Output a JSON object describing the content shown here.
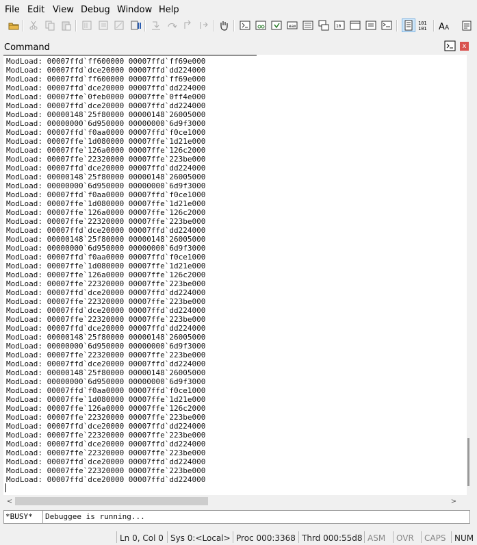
{
  "menu": [
    "File",
    "Edit",
    "View",
    "Debug",
    "Window",
    "Help"
  ],
  "toolbar": {
    "icons": [
      "open-icon",
      "cut-icon",
      "copy-icon",
      "paste-icon",
      "go-icon",
      "restart-icon",
      "stop-icon",
      "break-icon",
      "step-into-icon",
      "step-over-icon",
      "step-out-icon",
      "run-to-cursor-icon",
      "hand-icon",
      "command-window-icon",
      "watch-window-icon",
      "locals-window-icon",
      "registers-window-icon",
      "memory-window-icon",
      "call-stack-icon",
      "disassembly-icon",
      "scratch-pad-icon",
      "processes-threads-icon",
      "command-browser-icon",
      "source-mode-icon",
      "hex-mode-icon",
      "font-icon",
      "options-icon"
    ]
  },
  "command_window": {
    "title": "Command",
    "close_glyph": "x",
    "lines": [
      "ModLoad: 00007ffd`ff600000 00007ffd`ff69e000",
      "ModLoad: 00007ffd`dce20000 00007ffd`dd224000",
      "ModLoad: 00007ffd`ff600000 00007ffd`ff69e000",
      "ModLoad: 00007ffd`dce20000 00007ffd`dd224000",
      "ModLoad: 00007ffe`0feb0000 00007ffe`0ff4e000",
      "ModLoad: 00007ffd`dce20000 00007ffd`dd224000",
      "ModLoad: 00000148`25f80000 00000148`26005000",
      "ModLoad: 00000000`6d950000 00000000`6d9f3000",
      "ModLoad: 00007ffd`f0aa0000 00007ffd`f0ce1000",
      "ModLoad: 00007ffe`1d080000 00007ffe`1d21e000",
      "ModLoad: 00007ffe`126a0000 00007ffe`126c2000",
      "ModLoad: 00007ffe`22320000 00007ffe`223be000",
      "ModLoad: 00007ffd`dce20000 00007ffd`dd224000",
      "ModLoad: 00000148`25f80000 00000148`26005000",
      "ModLoad: 00000000`6d950000 00000000`6d9f3000",
      "ModLoad: 00007ffd`f0aa0000 00007ffd`f0ce1000",
      "ModLoad: 00007ffe`1d080000 00007ffe`1d21e000",
      "ModLoad: 00007ffe`126a0000 00007ffe`126c2000",
      "ModLoad: 00007ffe`22320000 00007ffe`223be000",
      "ModLoad: 00007ffd`dce20000 00007ffd`dd224000",
      "ModLoad: 00000148`25f80000 00000148`26005000",
      "ModLoad: 00000000`6d950000 00000000`6d9f3000",
      "ModLoad: 00007ffd`f0aa0000 00007ffd`f0ce1000",
      "ModLoad: 00007ffe`1d080000 00007ffe`1d21e000",
      "ModLoad: 00007ffe`126a0000 00007ffe`126c2000",
      "ModLoad: 00007ffe`22320000 00007ffe`223be000",
      "ModLoad: 00007ffd`dce20000 00007ffd`dd224000",
      "ModLoad: 00007ffe`22320000 00007ffe`223be000",
      "ModLoad: 00007ffd`dce20000 00007ffd`dd224000",
      "ModLoad: 00007ffe`22320000 00007ffe`223be000",
      "ModLoad: 00007ffd`dce20000 00007ffd`dd224000",
      "ModLoad: 00000148`25f80000 00000148`26005000",
      "ModLoad: 00000000`6d950000 00000000`6d9f3000",
      "ModLoad: 00007ffe`22320000 00007ffe`223be000",
      "ModLoad: 00007ffd`dce20000 00007ffd`dd224000",
      "ModLoad: 00000148`25f80000 00000148`26005000",
      "ModLoad: 00000000`6d950000 00000000`6d9f3000",
      "ModLoad: 00007ffd`f0aa0000 00007ffd`f0ce1000",
      "ModLoad: 00007ffe`1d080000 00007ffe`1d21e000",
      "ModLoad: 00007ffe`126a0000 00007ffe`126c2000",
      "ModLoad: 00007ffe`22320000 00007ffe`223be000",
      "ModLoad: 00007ffd`dce20000 00007ffd`dd224000",
      "ModLoad: 00007ffe`22320000 00007ffe`223be000",
      "ModLoad: 00007ffd`dce20000 00007ffd`dd224000",
      "ModLoad: 00007ffe`22320000 00007ffe`223be000",
      "ModLoad: 00007ffd`dce20000 00007ffd`dd224000",
      "ModLoad: 00007ffe`22320000 00007ffe`223be000",
      "ModLoad: 00007ffd`dce20000 00007ffd`dd224000"
    ],
    "scroll_left_glyph": "<",
    "scroll_right_glyph": ">",
    "prompt": "*BUSY*",
    "input_text": "Debuggee is running..."
  },
  "status_bar": {
    "segments": [
      {
        "text": "Ln 0, Col 0",
        "enabled": true
      },
      {
        "text": "Sys 0:<Local>",
        "enabled": true
      },
      {
        "text": "Proc 000:3368",
        "enabled": true
      },
      {
        "text": "Thrd 000:55d8",
        "enabled": true
      },
      {
        "text": "ASM",
        "enabled": false
      },
      {
        "text": "OVR",
        "enabled": false
      },
      {
        "text": "CAPS",
        "enabled": false
      },
      {
        "text": "NUM",
        "enabled": true
      }
    ]
  },
  "colors": {
    "window_bg": "#f0f0f0",
    "close_button": "#d9534f",
    "toggled_button": "#cde6fb"
  }
}
